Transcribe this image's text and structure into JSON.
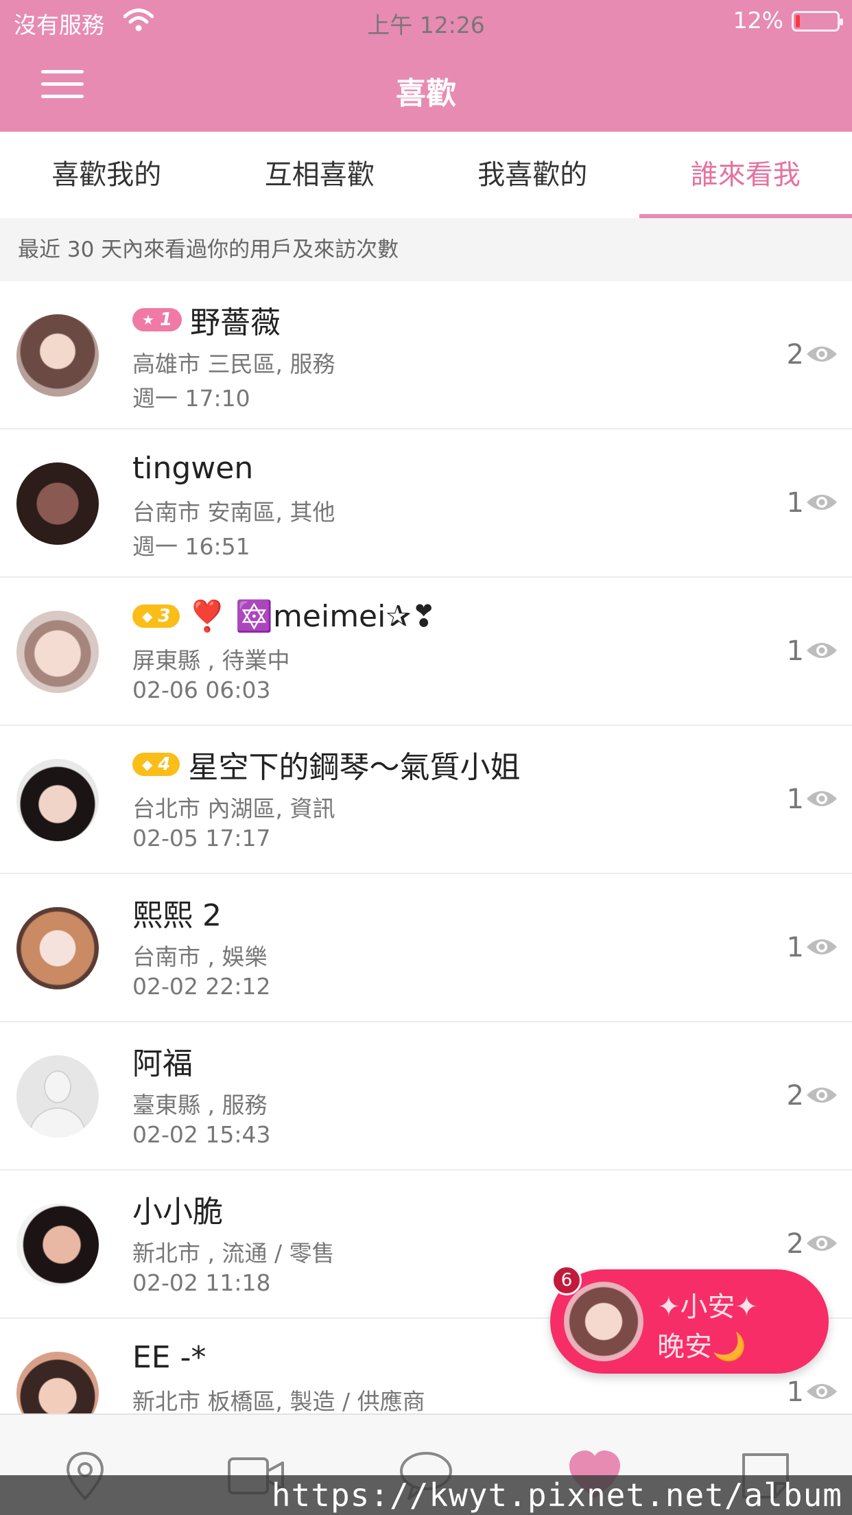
{
  "status_bar": {
    "carrier": "沒有服務",
    "time": "上午 12:26",
    "battery": "12%"
  },
  "header": {
    "title": "喜歡"
  },
  "tabs": [
    {
      "label": "喜歡我的"
    },
    {
      "label": "互相喜歡"
    },
    {
      "label": "我喜歡的"
    },
    {
      "label": "誰來看我",
      "active": true
    }
  ],
  "notice": "最近 30 天內來看過你的用戶及來訪次數",
  "visitors": [
    {
      "badge": {
        "type": "pink",
        "symbol": "★",
        "level": "1"
      },
      "name": "野薔薇",
      "detail": "高雄市 三民區, 服務",
      "time": "週一 17:10",
      "views": "2"
    },
    {
      "name": "tingwen",
      "detail": "台南市 安南區, 其他",
      "time": "週一 16:51",
      "views": "1"
    },
    {
      "badge": {
        "type": "gold",
        "symbol": "◆",
        "level": "3"
      },
      "name": "❣️ 🔯meimei✰❣",
      "detail": "屏東縣 , 待業中",
      "time": "02-06 06:03",
      "views": "1"
    },
    {
      "badge": {
        "type": "gold",
        "symbol": "◆",
        "level": "4"
      },
      "name": "星空下的鋼琴～氣質小姐",
      "detail": "台北市 內湖區, 資訊",
      "time": "02-05 17:17",
      "views": "1"
    },
    {
      "name": "熙熙 2",
      "detail": "台南市 , 娛樂",
      "time": "02-02 22:12",
      "views": "1"
    },
    {
      "name": "阿福",
      "detail": "臺東縣 , 服務",
      "time": "02-02 15:43",
      "views": "2"
    },
    {
      "name": "小小脆",
      "detail": "新北市 , 流通 / 零售",
      "time": "02-02 11:18",
      "views": "2"
    },
    {
      "name": "EE  -*",
      "detail": "新北市 板橋區, 製造 / 供應商",
      "time": "",
      "views": "1"
    }
  ],
  "chat_bubble": {
    "unread": "6",
    "line1": "✦小安✦",
    "line2": "晚安🌙"
  },
  "bottom_nav": [
    {
      "icon": "location-pin-icon"
    },
    {
      "icon": "video-camera-icon"
    },
    {
      "icon": "chat-bubble-icon"
    },
    {
      "icon": "heart-icon",
      "active": true
    },
    {
      "icon": "note-icon"
    }
  ],
  "watermark": "https://kwyt.pixnet.net/album",
  "colors": {
    "accent": "#e78bb3",
    "active_tab_text": "#e4729f",
    "bubble": "#f72d67",
    "badge_pink": "#f07aa5",
    "badge_gold": "#fbbd17"
  }
}
